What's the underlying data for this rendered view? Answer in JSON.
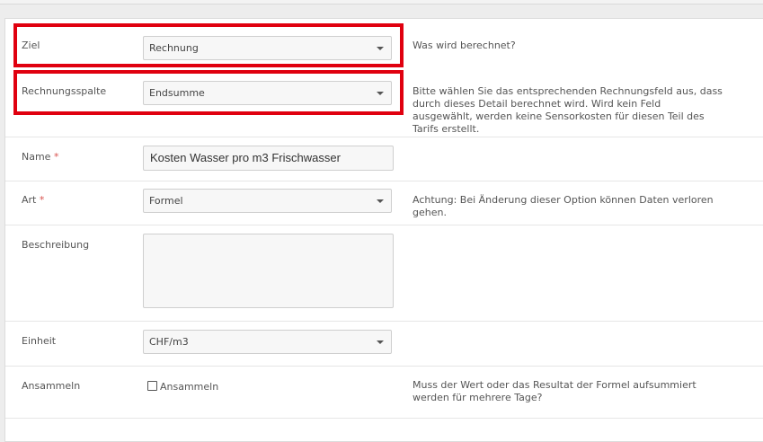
{
  "form": {
    "ziel": {
      "label": "Ziel",
      "value": "Rechnung",
      "help": "Was wird berechnet?"
    },
    "rechnungsspalte": {
      "label": "Rechnungsspalte",
      "value": "Endsumme",
      "help": "Bitte wählen Sie das entsprechenden Rechnungsfeld aus, dass durch dieses Detail berechnet wird. Wird kein Feld ausgewählt, werden keine Sensorkosten für diesen Teil des Tarifs erstellt."
    },
    "name": {
      "label": "Name",
      "required_mark": "*",
      "value": "Kosten Wasser pro m3 Frischwasser"
    },
    "art": {
      "label": "Art",
      "required_mark": "*",
      "value": "Formel",
      "help": "Achtung: Bei Änderung dieser Option können Daten verloren gehen."
    },
    "beschreibung": {
      "label": "Beschreibung",
      "value": ""
    },
    "einheit": {
      "label": "Einheit",
      "value": "CHF/m3"
    },
    "ansammeln": {
      "label": "Ansammeln",
      "checkbox_label": "Ansammeln",
      "checked": false,
      "help": "Muss der Wert oder das Resultat der Formel aufsummiert werden für mehrere Tage?"
    }
  },
  "colors": {
    "highlight": "#e0000f",
    "required": "#d9534f"
  },
  "icons": {
    "dropdown": "caret-down-icon"
  }
}
